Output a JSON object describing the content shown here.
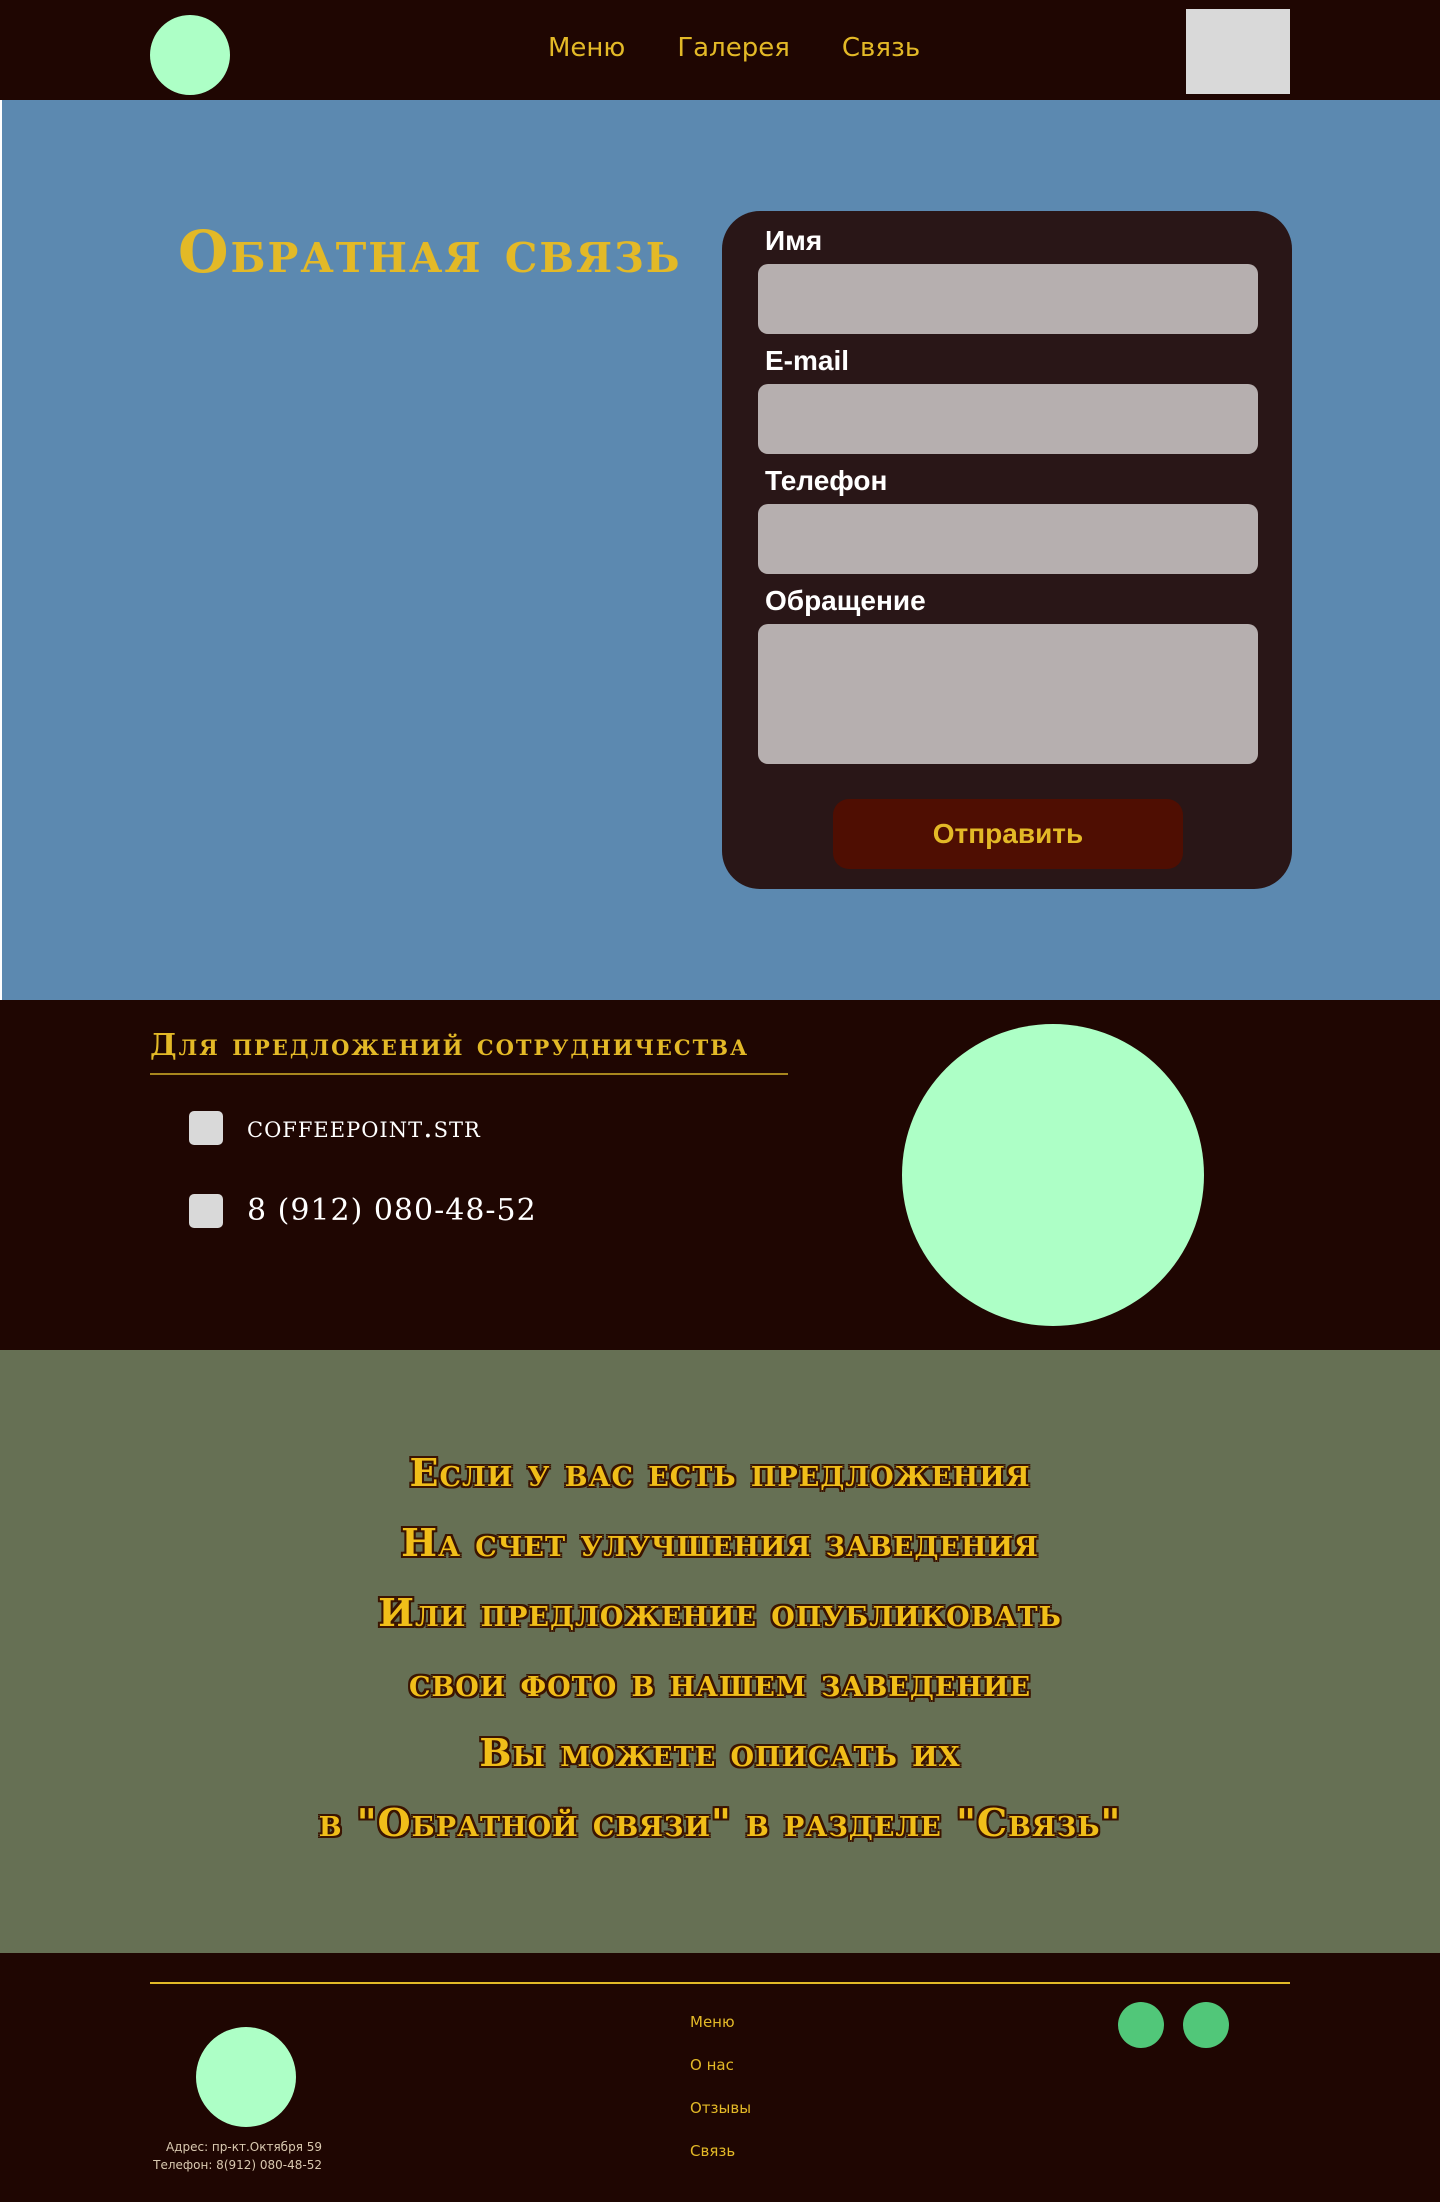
{
  "header": {
    "nav": [
      "Меню",
      "Галерея",
      "Связь"
    ]
  },
  "feedback": {
    "title": "Обратная связь",
    "form": {
      "name_label": "Имя",
      "email_label": "E-mail",
      "phone_label": "Телефон",
      "message_label": "Обращение",
      "submit_label": "Отправить"
    }
  },
  "partnership": {
    "title": "Для  предложений сотрудничества",
    "contacts": [
      "coffeepoint.str",
      "8 (912) 080-48-52"
    ]
  },
  "message": {
    "lines": [
      "Если у вас есть предложения",
      "На счет улучшения заведения",
      "Или предложение опубликовать",
      "свои фото в нашем заведение",
      "Вы можете описать их",
      "в \"Обратной связи\" в разделе \"Связь\""
    ]
  },
  "footer": {
    "address": "Адрес: пр-кт.Октября 59",
    "phone": "Телефон: 8(912) 080-48-52",
    "nav": [
      "Меню",
      "О нас",
      "Отзывы",
      "Связь"
    ]
  },
  "colors": {
    "dark_bg": "#1f0602",
    "accent_gold": "#e3b927",
    "mint": "#adffc6",
    "feedback_bg": "#5c89b0",
    "message_bg": "#667054",
    "form_bg": "#291617",
    "submit_bg": "#4f0e02",
    "social_green": "#51c779"
  }
}
